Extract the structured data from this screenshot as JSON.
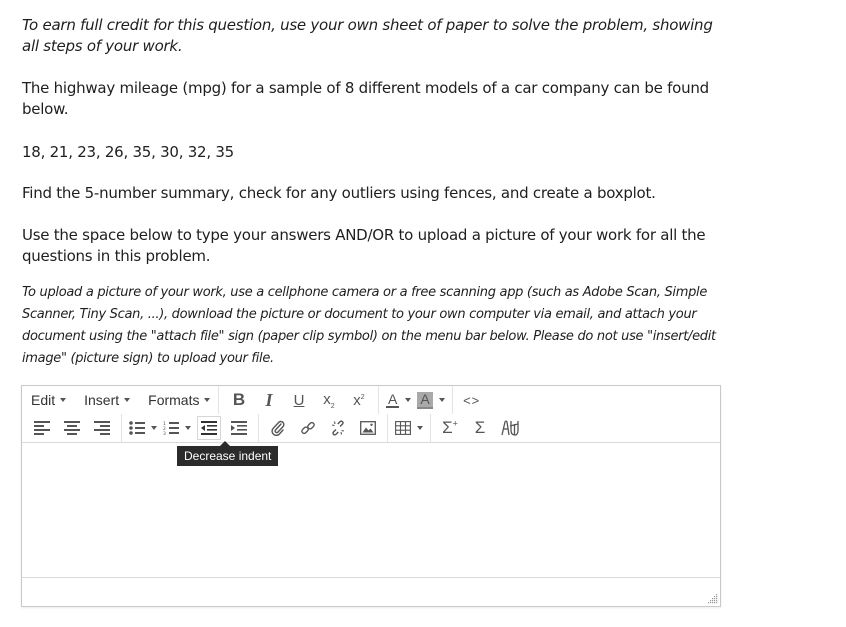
{
  "question": {
    "instruction": "To earn full credit for this question, use your own sheet of paper to solve the problem, showing all steps of your work.",
    "prompt": "The highway mileage (mpg) for a sample of 8 different models of a car company can be found below.",
    "data_values": "18, 21, 23, 26, 35, 30, 32, 35",
    "task": "Find the 5-number summary, check for any outliers using fences, and create a boxplot.",
    "answer_instruction": "Use the space below to type your answers AND/OR to upload a picture of your work for all the questions in this problem.",
    "upload_instruction": "To upload a picture of your work, use a cellphone camera or a free scanning app (such as Adobe Scan, Simple Scanner, Tiny Scan, ...), download the picture or document to your own computer via email, and attach your document using the \"attach file\" sign (paper clip symbol) on the menu bar below. Please do not use \"insert/edit image\" (picture sign) to upload your file."
  },
  "editor": {
    "menus": [
      {
        "label": "Edit",
        "icon": "caret-down-icon"
      },
      {
        "label": "Insert",
        "icon": "caret-down-icon"
      },
      {
        "label": "Formats",
        "icon": "caret-down-icon"
      }
    ],
    "toolbar_row1": [
      {
        "name": "bold",
        "glyph": "B",
        "icon": "bold-icon"
      },
      {
        "name": "italic",
        "glyph": "I",
        "icon": "italic-icon"
      },
      {
        "name": "underline",
        "glyph": "U",
        "icon": "underline-icon"
      },
      {
        "name": "subscript",
        "glyph": "x₂",
        "icon": "subscript-icon"
      },
      {
        "name": "superscript",
        "glyph": "x²",
        "icon": "superscript-icon"
      },
      {
        "name": "text-color",
        "glyph": "A",
        "icon": "text-color-icon"
      },
      {
        "name": "background-color",
        "glyph": "A",
        "icon": "background-color-icon"
      },
      {
        "name": "source-code",
        "glyph": "<>",
        "icon": "source-code-icon"
      }
    ],
    "toolbar_row2": [
      {
        "name": "align-left",
        "icon": "align-left-icon"
      },
      {
        "name": "align-center",
        "icon": "align-center-icon"
      },
      {
        "name": "align-right",
        "icon": "align-right-icon"
      },
      {
        "name": "bullet-list",
        "icon": "bullet-list-icon"
      },
      {
        "name": "numbered-list",
        "icon": "numbered-list-icon"
      },
      {
        "name": "decrease-indent",
        "icon": "decrease-indent-icon",
        "active": true
      },
      {
        "name": "increase-indent",
        "icon": "increase-indent-icon"
      },
      {
        "name": "attach-file",
        "icon": "paperclip-icon"
      },
      {
        "name": "insert-link",
        "icon": "link-icon"
      },
      {
        "name": "remove-link",
        "icon": "unlink-icon"
      },
      {
        "name": "insert-image",
        "icon": "image-icon"
      },
      {
        "name": "table",
        "icon": "table-icon"
      },
      {
        "name": "insert-equation",
        "glyph": "Σ+",
        "icon": "sigma-plus-icon"
      },
      {
        "name": "equation",
        "glyph": "Σ",
        "icon": "sigma-icon"
      },
      {
        "name": "special-character",
        "icon": "special-character-icon"
      }
    ],
    "tooltip": "Decrease indent",
    "content": "",
    "colors": {
      "text_color_underline": "#555555",
      "background_color_fill": "#a9a9a9",
      "tooltip_bg": "#2b2b2b"
    }
  }
}
